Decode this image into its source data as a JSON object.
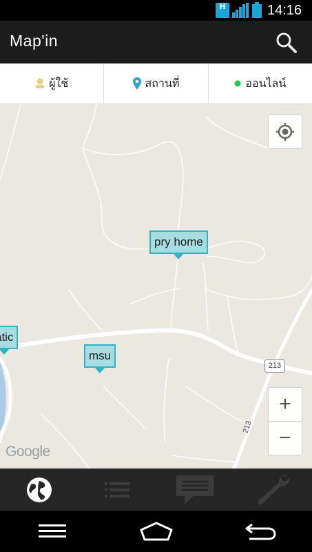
{
  "status_bar": {
    "network_badge": "H",
    "time": "14:16"
  },
  "app_bar": {
    "title": "Map'in",
    "search_icon": "search-icon"
  },
  "filter_tabs": [
    {
      "label": "ผู้ใช้",
      "icon": "user-icon",
      "icon_color": "#e6d27a"
    },
    {
      "label": "สถานที่",
      "icon": "location-pin-icon",
      "icon_color": "#2aa6c8"
    },
    {
      "label": "ออนไลน์",
      "icon": "online-dot-icon",
      "icon_color": "#1ec84b"
    }
  ],
  "map": {
    "markers": [
      {
        "label": "pry home"
      },
      {
        "label": "atic"
      },
      {
        "label": "msu"
      }
    ],
    "road_shields": [
      "213",
      "213"
    ],
    "attribution": "Google",
    "zoom_in_label": "+",
    "zoom_out_label": "−"
  },
  "bottom_nav": [
    {
      "icon": "globe-icon",
      "active": true
    },
    {
      "icon": "list-icon",
      "active": false
    },
    {
      "icon": "chat-icon",
      "active": false
    },
    {
      "icon": "wrench-icon",
      "active": false
    }
  ],
  "colors": {
    "accent": "#2fb3c5",
    "marker_fill": "#a7dde1",
    "map_background": "#ebe8e1",
    "app_bar": "#1c1c1c",
    "bottom_nav": "#262626"
  }
}
